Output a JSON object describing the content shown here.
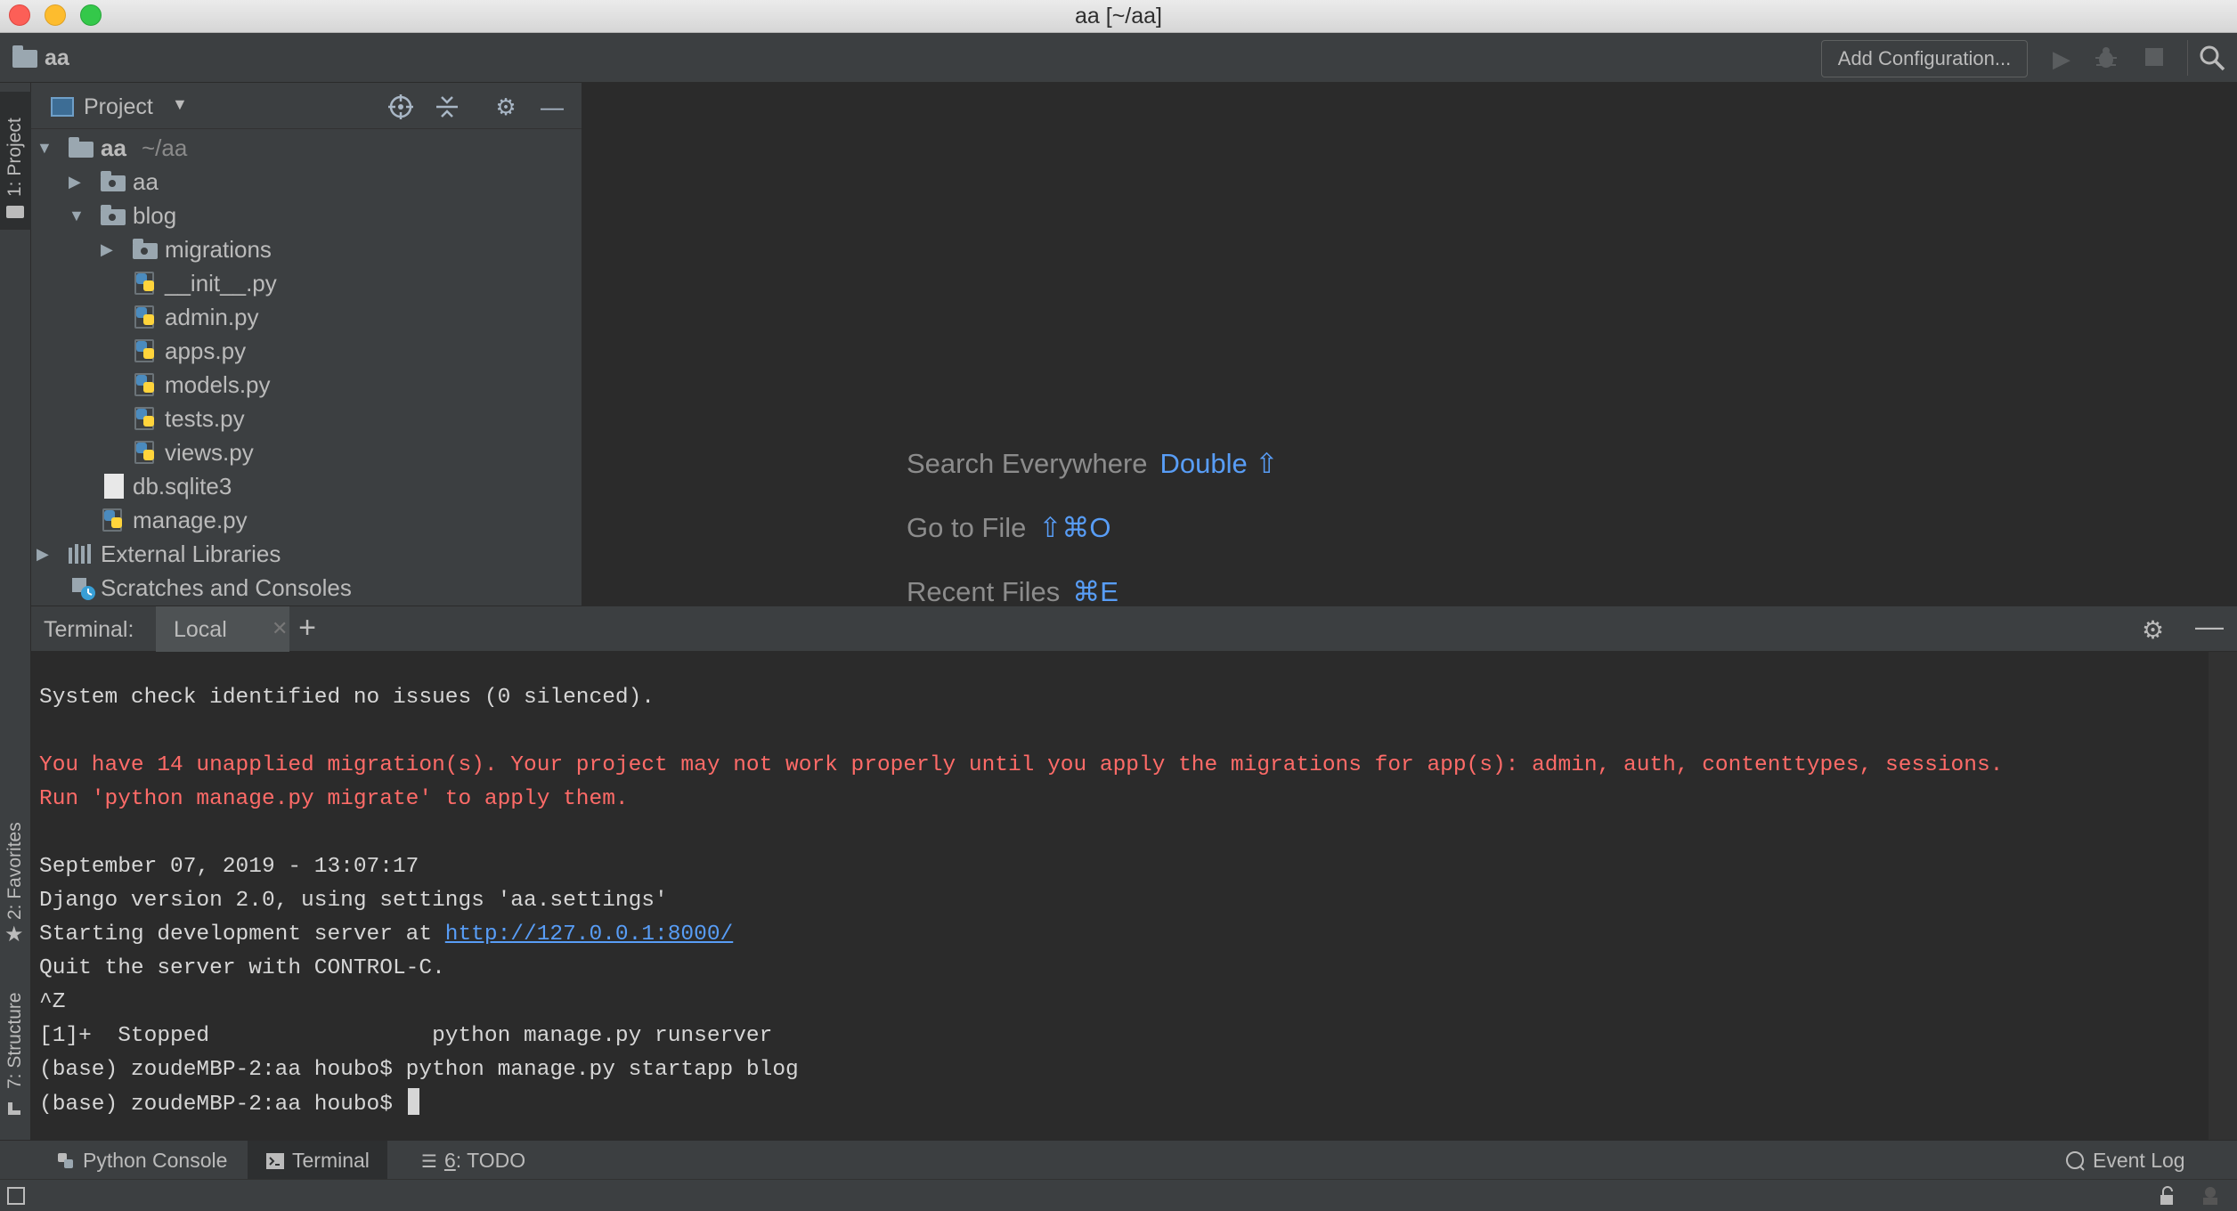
{
  "window": {
    "title": "aa [~/aa]"
  },
  "navbar": {
    "project_name": "aa",
    "add_configuration_label": "Add Configuration...",
    "icons": [
      "run-icon",
      "debug-icon",
      "stop-icon",
      "search-icon"
    ]
  },
  "left_strip": {
    "project_tab": "1: Project",
    "favorites_tab": "2: Favorites",
    "structure_tab": "7: Structure"
  },
  "project_panel": {
    "title": "Project",
    "tree": {
      "root_label": "aa",
      "root_path": "~/aa",
      "aa_folder": "aa",
      "blog_folder": "blog",
      "migrations_folder": "migrations",
      "files_blog": [
        "__init__.py",
        "admin.py",
        "apps.py",
        "models.py",
        "tests.py",
        "views.py"
      ],
      "db_file": "db.sqlite3",
      "manage_file": "manage.py",
      "external_libraries": "External Libraries",
      "scratches": "Scratches and Consoles"
    }
  },
  "editor_hints": {
    "search_everywhere": "Search Everywhere",
    "search_everywhere_shortcut": "Double ⇧",
    "go_to_file": "Go to File",
    "go_to_file_shortcut": "⇧⌘O",
    "recent_files": "Recent Files",
    "recent_files_shortcut": "⌘E"
  },
  "terminal": {
    "label": "Terminal:",
    "tab": "Local",
    "lines": {
      "l1": "System check identified no issues (0 silenced).",
      "l2": "You have 14 unapplied migration(s). Your project may not work properly until you apply the migrations for app(s): admin, auth, contenttypes, sessions.",
      "l3": "Run 'python manage.py migrate' to apply them.",
      "l4": "September 07, 2019 - 13:07:17",
      "l5": "Django version 2.0, using settings 'aa.settings'",
      "l6_prefix": "Starting development server at ",
      "l6_link": "http://127.0.0.1:8000/",
      "l7": "Quit the server with CONTROL-C.",
      "l8": "^Z",
      "l9": "[1]+  Stopped                 python manage.py runserver",
      "l10": "(base) zoudeMBP-2:aa houbo$ python manage.py startapp blog",
      "l11": "(base) zoudeMBP-2:aa houbo$ "
    }
  },
  "bottom_bar": {
    "python_console": "Python Console",
    "terminal": "Terminal",
    "todo_num": "6",
    "todo_rest": ": TODO",
    "event_log": "Event Log"
  },
  "colors": {
    "accent": "#589df6",
    "error": "#ff6b68",
    "panel": "#3c3f41",
    "editor": "#2b2b2b"
  }
}
